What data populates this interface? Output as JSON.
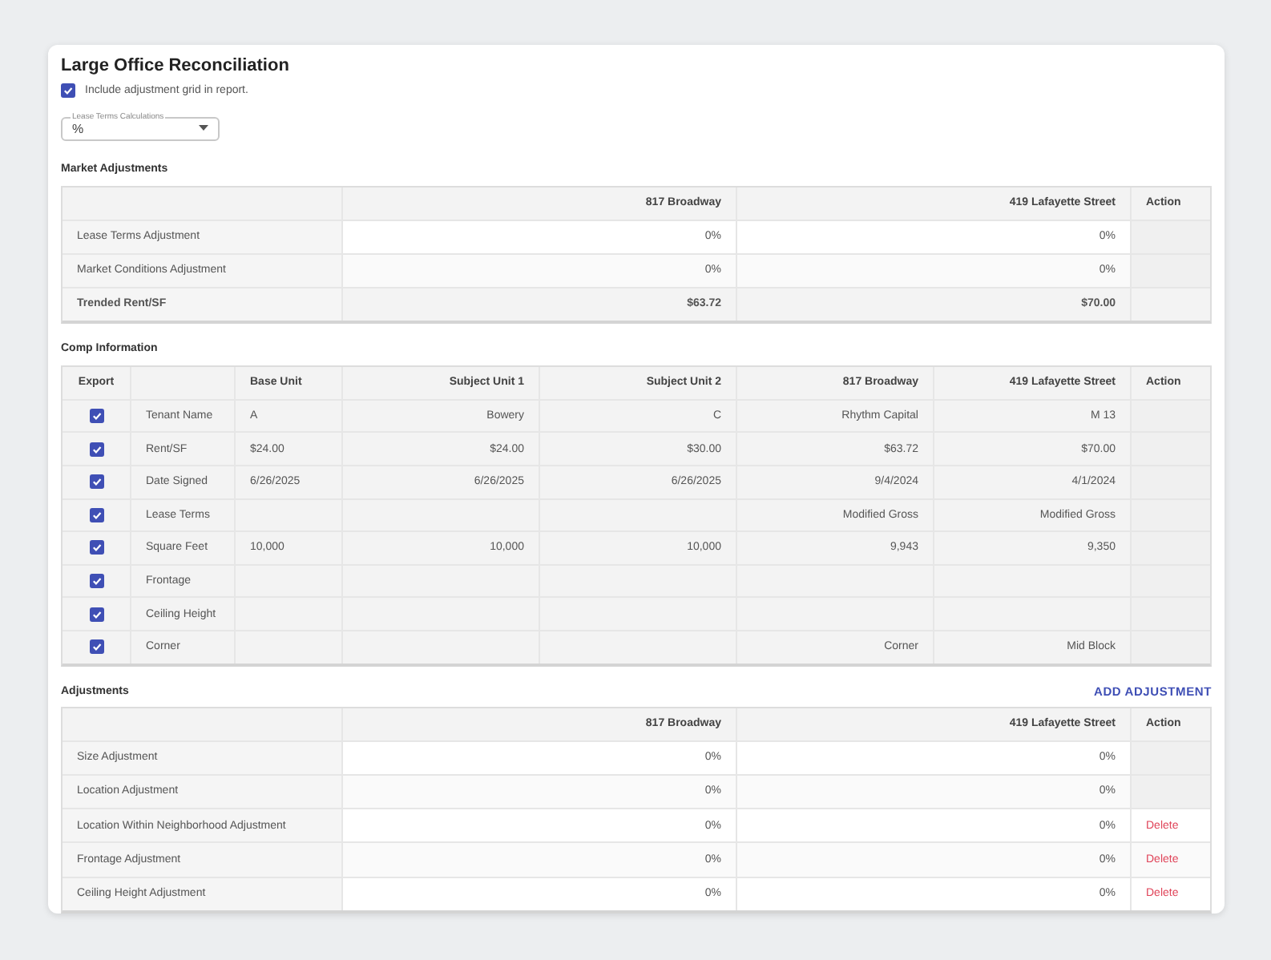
{
  "title": "Large Office Reconciliation",
  "include_checkbox": {
    "label": "Include adjustment grid in report.",
    "checked": true
  },
  "calculation_select": {
    "label": "Lease Terms Calculations",
    "value": "%"
  },
  "market_adjustments": {
    "title": "Market Adjustments",
    "headers": [
      "817 Broadway",
      "419 Lafayette Street"
    ],
    "action_header": "Action",
    "rows": [
      {
        "label": "Lease Terms Adjustment",
        "kind": "value",
        "values": [
          "0%",
          "0%"
        ]
      },
      {
        "label": "Market Conditions Adjustment",
        "kind": "value",
        "values": [
          "0%",
          "0%"
        ]
      },
      {
        "label": "Trended Rent/SF",
        "kind": "total",
        "values": [
          "$63.72",
          "$70.00"
        ]
      }
    ]
  },
  "comp_information": {
    "title": "Comp Information",
    "export_header": "Export",
    "headers": [
      "Base Unit",
      "Subject Unit 1",
      "Subject Unit 2",
      "817 Broadway",
      "419 Lafayette Street"
    ],
    "action_header": "Action",
    "rows": [
      {
        "label": "Tenant Name",
        "export": true,
        "values": {
          "col_1": "A",
          "col_2": "Bowery",
          "col_3": "C",
          "col_4": "Rhythm Capital",
          "col_5": "M 13"
        }
      },
      {
        "label": "Rent/SF",
        "export": true,
        "values": {
          "col_1": "$24.00",
          "col_2": "$24.00",
          "col_3": "$30.00",
          "col_4": "$63.72",
          "col_5": "$70.00"
        }
      },
      {
        "label": "Date Signed",
        "export": true,
        "values": {
          "col_1": "6/26/2025",
          "col_2": "6/26/2025",
          "col_3": "6/26/2025",
          "col_4": "9/4/2024",
          "col_5": "4/1/2024"
        }
      },
      {
        "label": "Lease Terms",
        "export": true,
        "values": {
          "col_4": "Modified Gross",
          "col_5": "Modified Gross"
        }
      },
      {
        "label": "Square Feet",
        "export": true,
        "values": {
          "col_1": "10,000",
          "col_2": "10,000",
          "col_3": "10,000",
          "col_4": "9,943",
          "col_5": "9,350"
        }
      },
      {
        "label": "Frontage",
        "export": true
      },
      {
        "label": "Ceiling Height",
        "export": true
      },
      {
        "label": "Corner",
        "export": true,
        "values": {
          "col_4": "Corner",
          "col_5": "Mid Block"
        }
      }
    ]
  },
  "adjustments": {
    "title": "Adjustments",
    "add_button": "ADD ADJUSTMENT",
    "headers": [
      "817 Broadway",
      "419 Lafayette Street"
    ],
    "action_header": "Action",
    "rows": [
      {
        "label": "Size Adjustment",
        "values": [
          "0%",
          "0%"
        ]
      },
      {
        "label": "Location Adjustment",
        "values": [
          "0%",
          "0%"
        ]
      },
      {
        "label": "Location Within Neighborhood Adjustment",
        "values": [
          "0%",
          "0%"
        ],
        "action": "Delete"
      },
      {
        "label": "Frontage Adjustment",
        "values": [
          "0%",
          "0%"
        ],
        "action": "Delete"
      },
      {
        "label": "Ceiling Height Adjustment",
        "values": [
          "0%",
          "0%"
        ],
        "action": "Delete"
      }
    ]
  }
}
